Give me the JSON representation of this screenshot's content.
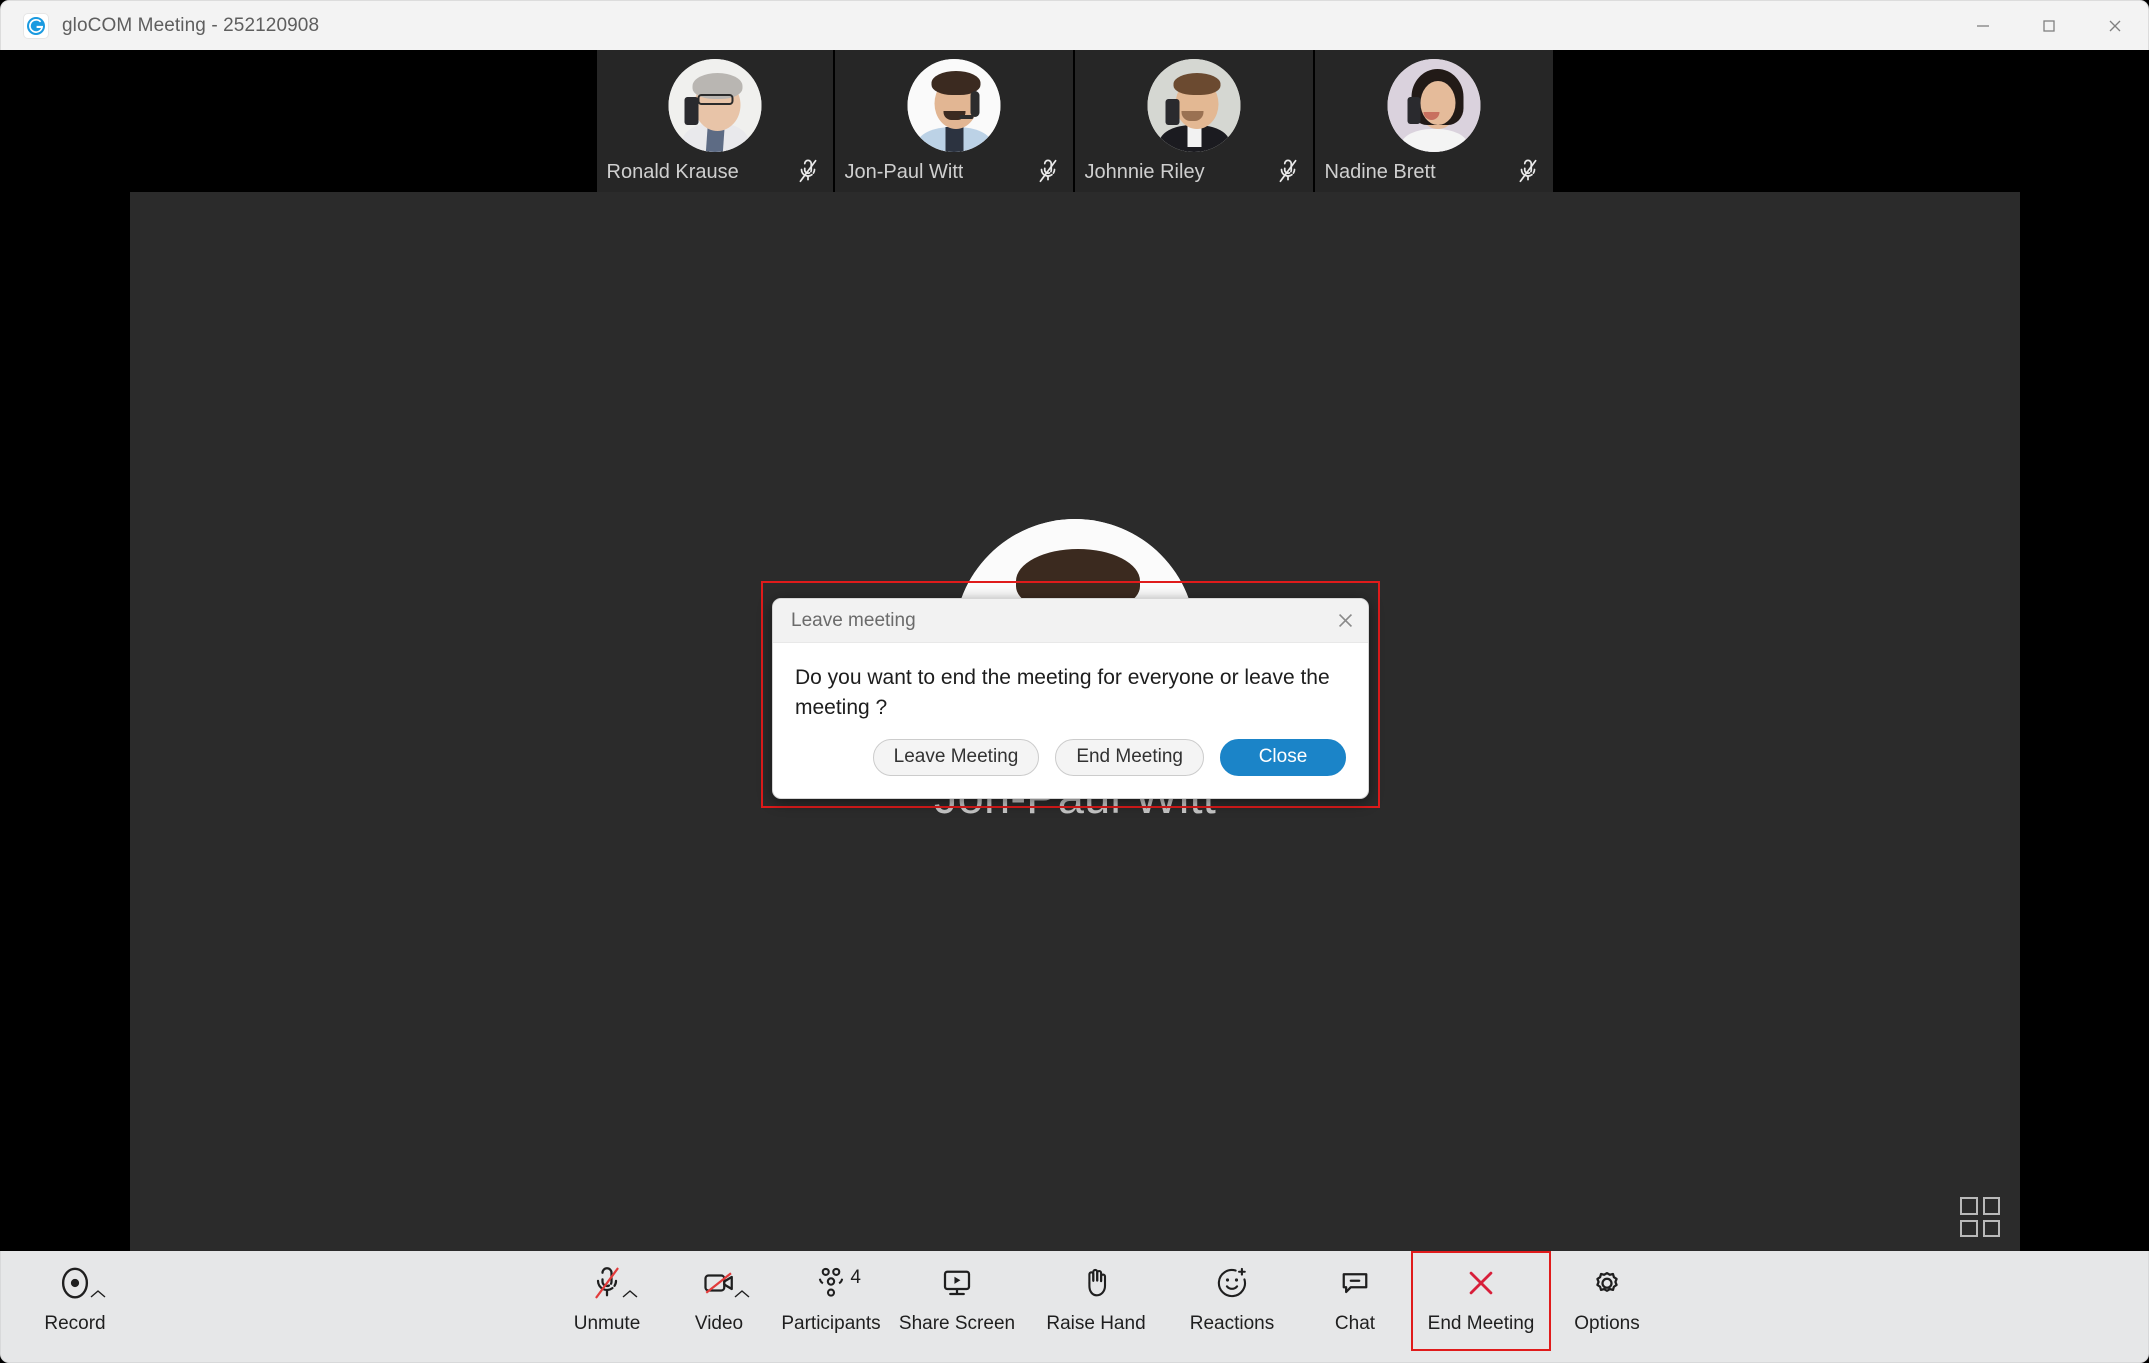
{
  "window": {
    "title": "gloCOM Meeting - 252120908",
    "logo_icon": "glocom-logo-icon",
    "minimize_icon": "minimize-icon",
    "maximize_icon": "maximize-icon",
    "close_icon": "close-icon"
  },
  "participant_strip": {
    "items": [
      {
        "name": "Ronald Krause",
        "mic_icon": "mic-muted-icon",
        "muted": true
      },
      {
        "name": "Jon-Paul Witt",
        "mic_icon": "mic-muted-icon",
        "muted": true
      },
      {
        "name": "Johnnie Riley",
        "mic_icon": "mic-muted-icon",
        "muted": true
      },
      {
        "name": "Nadine Brett",
        "mic_icon": "mic-muted-icon",
        "muted": true
      }
    ]
  },
  "stage": {
    "active_speaker": "Jon-Paul Witt",
    "grid_view_icon": "grid-view-icon"
  },
  "dialog": {
    "title": "Leave meeting",
    "close_icon": "close-icon",
    "message": "Do you want to end the meeting for everyone or leave the meeting ?",
    "buttons": [
      {
        "label": "Leave Meeting",
        "style": "secondary"
      },
      {
        "label": "End Meeting",
        "style": "secondary"
      },
      {
        "label": "Close",
        "style": "primary"
      }
    ],
    "highlight_color": "#e01b1b",
    "primary_color": "#1b84c8"
  },
  "toolbar": {
    "items": [
      {
        "label": "Record",
        "icon": "record-icon",
        "caret": true,
        "badge": null
      },
      {
        "label": "Unmute",
        "icon": "mic-muted-icon",
        "caret": true,
        "badge": null
      },
      {
        "label": "Video",
        "icon": "video-off-icon",
        "caret": true,
        "badge": null
      },
      {
        "label": "Participants",
        "icon": "participants-icon",
        "caret": false,
        "badge": "4"
      },
      {
        "label": "Share Screen",
        "icon": "share-screen-icon",
        "caret": false,
        "badge": null
      },
      {
        "label": "Raise Hand",
        "icon": "raise-hand-icon",
        "caret": false,
        "badge": null
      },
      {
        "label": "Reactions",
        "icon": "reactions-icon",
        "caret": false,
        "badge": null
      },
      {
        "label": "Chat",
        "icon": "chat-icon",
        "caret": false,
        "badge": null
      },
      {
        "label": "End Meeting",
        "icon": "end-meeting-icon",
        "caret": false,
        "badge": null,
        "highlighted": true
      },
      {
        "label": "Options",
        "icon": "gear-icon",
        "caret": false,
        "badge": null
      }
    ]
  }
}
